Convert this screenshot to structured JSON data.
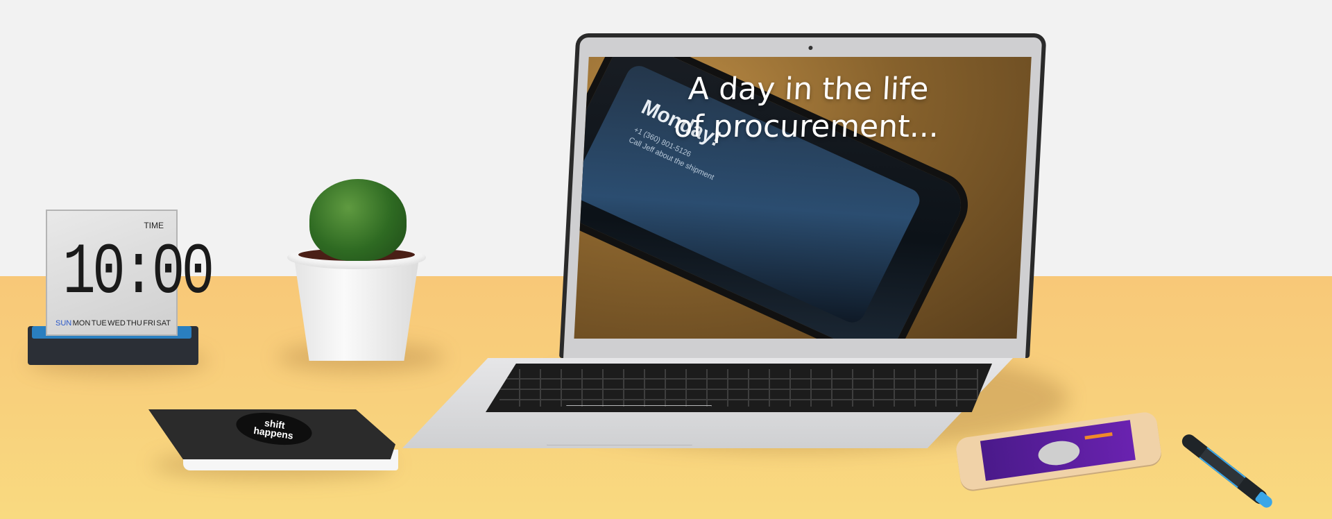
{
  "screen": {
    "headline_line1": "A day in the life",
    "headline_line2": "of procurement...",
    "phone_day": "Monday!",
    "phone_line1": "+1 (360) 801-5126",
    "phone_line2": "Call Jeff about the shipment"
  },
  "clock": {
    "label": "TIME",
    "time": "10:00",
    "days": [
      "SUN",
      "MON",
      "TUE",
      "WED",
      "THU",
      "FRI",
      "SAT"
    ],
    "active_day": "SUN"
  },
  "notebook": {
    "badge_line1": "shift",
    "badge_line2": "happens"
  },
  "colors": {
    "wall": "#f2f2f2",
    "desk": "#f8cf7c",
    "accent_blue": "#2a7fc0",
    "phone_purple": "#5a1ea0"
  }
}
